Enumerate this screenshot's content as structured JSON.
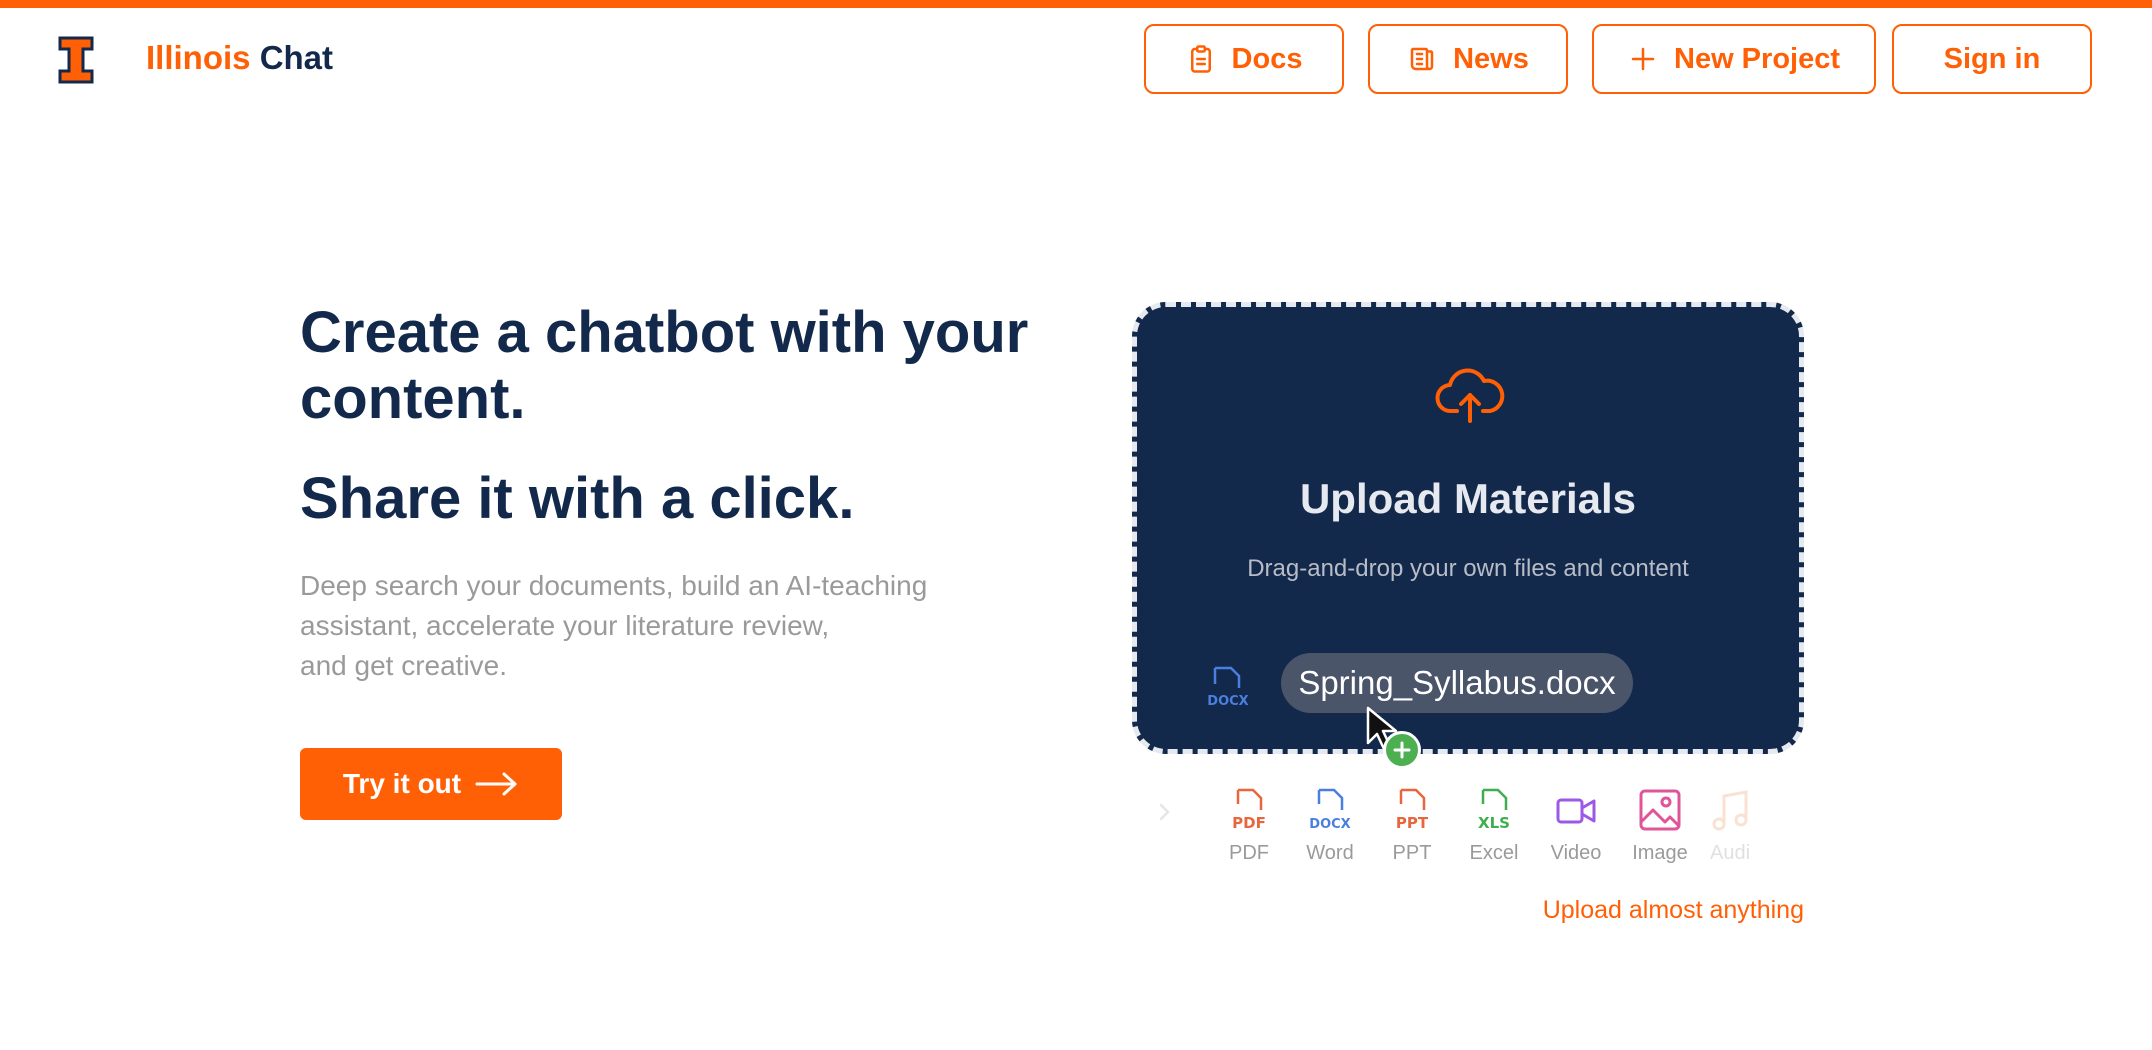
{
  "brand": {
    "name_part1": "Illinois",
    "name_part2": "Chat",
    "logo_icon": "illinois-block-i-icon"
  },
  "nav": {
    "docs_label": "Docs",
    "docs_icon": "clipboard-icon",
    "news_label": "News",
    "news_icon": "newspaper-icon",
    "new_project_label": "New Project",
    "new_project_icon": "plus-icon",
    "sign_in_label": "Sign in"
  },
  "hero": {
    "title_line1": "Create a chatbot with your content.",
    "title_line2": "Share it with a click.",
    "desc_line1": "Deep search your documents, build an AI-teaching",
    "desc_line2": "assistant, accelerate your literature review,",
    "desc_line3": "and get creative.",
    "cta_label": "Try it out",
    "cta_icon": "arrow-right-icon"
  },
  "upload_demo": {
    "title": "Upload Materials",
    "subtitle": "Drag-and-drop your own files and content",
    "file_name": "Spring_Syllabus.docx",
    "file_icon_text": "DOCX",
    "caption": "Upload almost anything"
  },
  "file_types": [
    {
      "label": "PDF",
      "tag": "PDF",
      "color": "#e8663d"
    },
    {
      "label": "Word",
      "tag": "DOCX",
      "color": "#4a7fe0"
    },
    {
      "label": "PPT",
      "tag": "PPT",
      "color": "#e8663d"
    },
    {
      "label": "Excel",
      "tag": "XLS",
      "color": "#3fae4e"
    },
    {
      "label": "Video",
      "tag": "",
      "color": "#9b59e6"
    },
    {
      "label": "Image",
      "tag": "",
      "color": "#e0559a"
    },
    {
      "label": "Audi",
      "tag": "",
      "color": "#f0a070"
    }
  ],
  "colors": {
    "accent": "#ff5f05",
    "navy": "#13294b",
    "muted": "#9a9a9a"
  }
}
